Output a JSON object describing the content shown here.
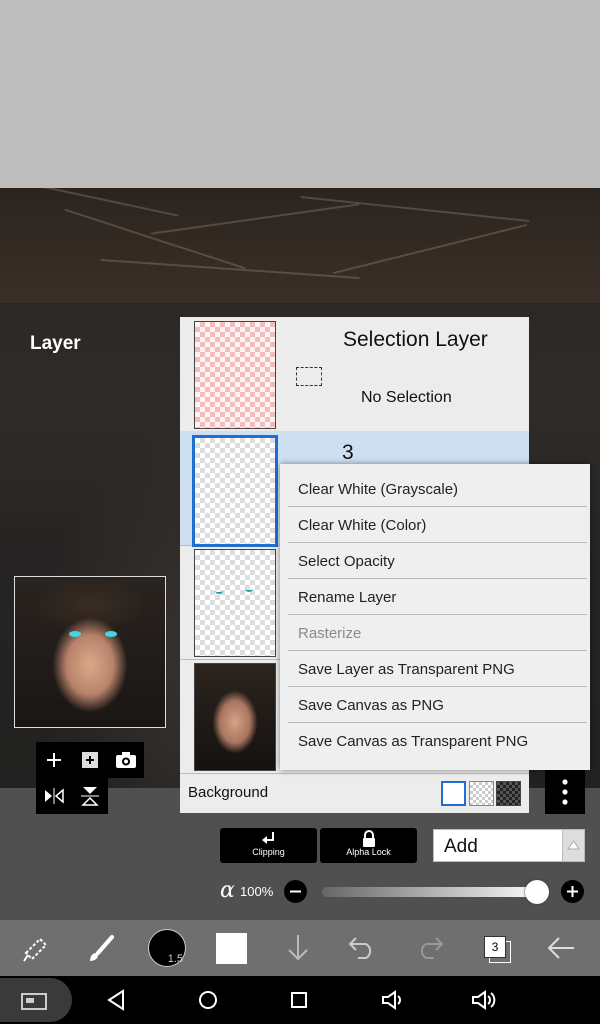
{
  "panel": {
    "title": "Layer"
  },
  "layers": {
    "selection": {
      "name": "Selection Layer",
      "status": "No Selection"
    },
    "active": {
      "name": "3"
    },
    "background_label": "Background"
  },
  "menu": {
    "items": [
      {
        "label": "Clear White (Grayscale)",
        "enabled": true
      },
      {
        "label": "Clear White (Color)",
        "enabled": true
      },
      {
        "label": "Select Opacity",
        "enabled": true
      },
      {
        "label": "Rename Layer",
        "enabled": true
      },
      {
        "label": "Rasterize",
        "enabled": false
      },
      {
        "label": "Save Layer as Transparent PNG",
        "enabled": true
      },
      {
        "label": "Save Canvas as PNG",
        "enabled": true
      },
      {
        "label": "Save Canvas as Transparent PNG",
        "enabled": true
      }
    ]
  },
  "controls": {
    "clipping_label": "Clipping",
    "alpha_lock_label": "Alpha Lock",
    "blend_mode": "Add",
    "alpha_symbol": "α",
    "opacity": "100%",
    "opacity_fraction": 1.0
  },
  "toolbar": {
    "brush_size": "1.5",
    "layer_count": "3"
  },
  "colors": {
    "accent": "#1e6fd0",
    "eye": "#3fd7e0",
    "panel": "#ececec",
    "menu": "#efefef"
  }
}
